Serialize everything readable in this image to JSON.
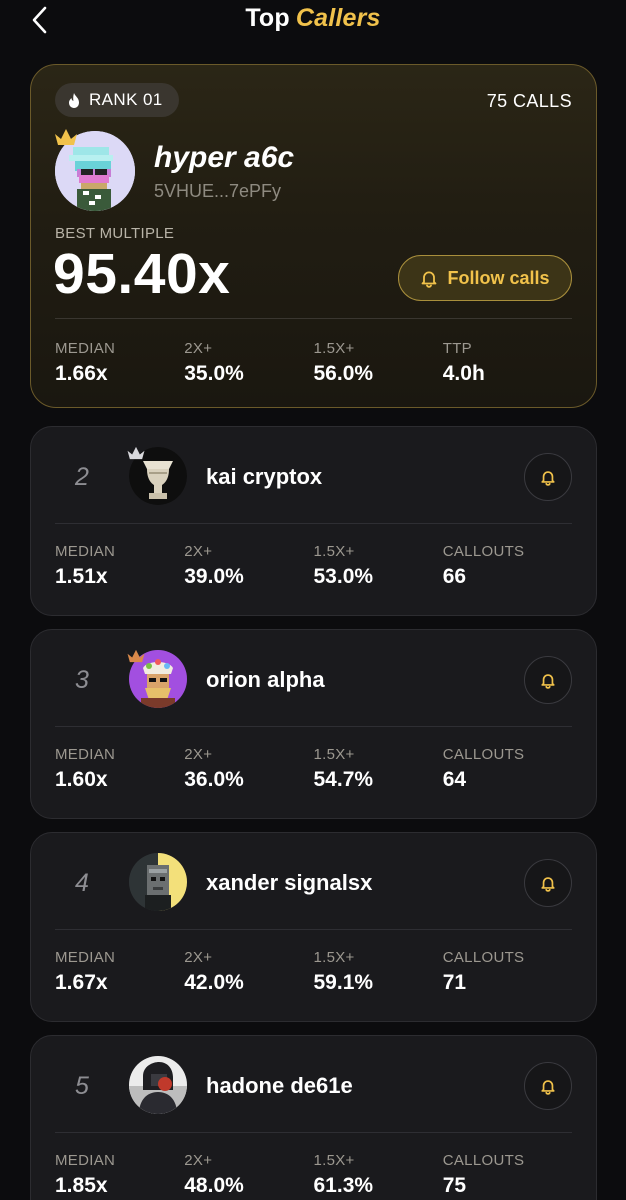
{
  "header": {
    "title_plain": "Top",
    "title_accent": "Callers"
  },
  "top_caller": {
    "rank_label": "RANK 01",
    "calls_label": "75 CALLS",
    "name": "hyper a6c",
    "address": "5VHUE...7ePFy",
    "best_label": "BEST MULTIPLE",
    "best_value": "95.40x",
    "follow_label": "Follow calls",
    "stats": [
      {
        "key": "MEDIAN",
        "value": "1.66x"
      },
      {
        "key": "2X+",
        "value": "35.0%"
      },
      {
        "key": "1.5X+",
        "value": "56.0%"
      },
      {
        "key": "TTP",
        "value": "4.0h"
      }
    ]
  },
  "callers": [
    {
      "rank": "2",
      "name": "kai cryptox",
      "stats": [
        {
          "key": "MEDIAN",
          "value": "1.51x"
        },
        {
          "key": "2X+",
          "value": "39.0%"
        },
        {
          "key": "1.5X+",
          "value": "53.0%"
        },
        {
          "key": "CALLOUTS",
          "value": "66"
        }
      ]
    },
    {
      "rank": "3",
      "name": "orion alpha",
      "stats": [
        {
          "key": "MEDIAN",
          "value": "1.60x"
        },
        {
          "key": "2X+",
          "value": "36.0%"
        },
        {
          "key": "1.5X+",
          "value": "54.7%"
        },
        {
          "key": "CALLOUTS",
          "value": "64"
        }
      ]
    },
    {
      "rank": "4",
      "name": "xander signalsx",
      "stats": [
        {
          "key": "MEDIAN",
          "value": "1.67x"
        },
        {
          "key": "2X+",
          "value": "42.0%"
        },
        {
          "key": "1.5X+",
          "value": "59.1%"
        },
        {
          "key": "CALLOUTS",
          "value": "71"
        }
      ]
    },
    {
      "rank": "5",
      "name": "hadone de61e",
      "stats": [
        {
          "key": "MEDIAN",
          "value": "1.85x"
        },
        {
          "key": "2X+",
          "value": "48.0%"
        },
        {
          "key": "1.5X+",
          "value": "61.3%"
        },
        {
          "key": "CALLOUTS",
          "value": "75"
        }
      ]
    }
  ],
  "colors": {
    "accent": "#f1c24b",
    "background": "#0c0c0e",
    "card": "#1a1a1d",
    "top_card_border": "#6b5a2a"
  },
  "icons": {
    "back": "chevron-left-icon",
    "rank": "flame-icon",
    "follow": "bell-icon",
    "crown": "crown-icon"
  }
}
